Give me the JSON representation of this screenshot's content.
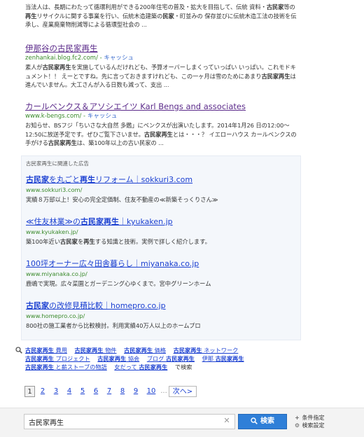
{
  "results": [
    {
      "title": "",
      "url": "",
      "cache": "",
      "snippet_html": "当法人は、長期にわたって循環利用ができる200年住宅の普及・拡大を目指して、伝統 資料・<b>古民家</b>等の<b>再生</b>リサイクルに関する事業を行い、伝統木造建築の<b>民家</b>・町並みの 保存並びに伝統木造工法の技術を伝承し、産業廃棄物削減等による循環型社会の ..."
    },
    {
      "title": "伊那谷の古民家再生",
      "url": "zenhankai.blog.fc2.com/",
      "cache": "キャッシュ",
      "snippet_html": "素人が<b>古民家再生</b>を実施しているんだけれども、予算オーバーしまくっていっぱい いっぱい。これモドキュメント！！ えーとですね。先に言っておきますけれども、この一ヶ月は雪のためにあまり<b>古民家再生</b>は進んでいません。大工さんが入る日数も減って、支出 ..."
    },
    {
      "title": "カールベンクス＆アソシエイツ Karl Bengs and associates",
      "url": "www.k-bengs.com/",
      "cache": "キャッシュ",
      "snippet_html": "お知らせ、BSフジ「ちいさな大自然 多鑑」にベンクスが出演いたします。2014年1月26 日の12:00～12:50に放送予定です。ぜひご覧下さいませ。<b>古民家再生</b>とは・・・？ イエローハウス カールベンクスの手がける<b>古民家再生</b>は、築100年以上の古い民家の ..."
    }
  ],
  "ads": {
    "header": "古民家再生に関連した広告",
    "items": [
      {
        "title_html": "<b>古民家</b>を丸ごと<b>再生</b>リフォーム｜sokkuri3.com",
        "url": "www.sokkuri3.com/",
        "desc_html": "実績８万邸以上！安心の完全定価制、住友不動産の≪新築そっくりさん≫"
      },
      {
        "title_html": "≪住友林業≫の<b>古民家再生</b>｜kyukaken.jp",
        "url": "www.kyukaken.jp/",
        "desc_html": "築100年近い<b>古民家</b>を<b>再生</b>する知識と技術。実例で詳しく紹介します。"
      },
      {
        "title_html": "100坪オーナー広々田舎暮らし｜miyanaka.co.jp",
        "url": "www.miyanaka.co.jp/",
        "desc_html": "鹿嶋で実現。広々菜園とガーデニング心ゆくまで。宮中グリーンホーム"
      },
      {
        "title_html": "<b>古民家</b>の改修見積比較｜homepro.co.jp",
        "url": "www.homepro.co.jp/",
        "desc_html": "800社の施工業者から比較検討。利用実績40万人以上のホームプロ"
      }
    ]
  },
  "related": {
    "rows": [
      [
        "<b>古民家再生</b> 費用",
        "<b>古民家再生</b> 物件",
        "<b>古民家再生</b> 価格",
        "<b>古民家再生</b> ネットワーク"
      ],
      [
        "<b>古民家再生</b> プロジェクト",
        "<b>古民家再生</b> 協会",
        "ブログ <b>古民家再生</b>",
        "伊那 <b>古民家再生</b>"
      ],
      [
        "<b>古民家再生</b> と薪ストーブの物語 ",
        "女だって <b>古民家再生</b>"
      ]
    ],
    "suffix": "で検索"
  },
  "pagination": {
    "pages": [
      "1",
      "2",
      "3",
      "4",
      "5",
      "6",
      "7",
      "8",
      "9",
      "10"
    ],
    "dots": "...",
    "next": "次へ>"
  },
  "searchbar": {
    "query": "古民家再生",
    "button_label": "検索",
    "link_conditions": "条件指定",
    "link_settings": "検索設定"
  },
  "colors": {
    "ad_title": "#1a3fd1",
    "visited_title": "#5b2a8a",
    "url_green": "#3a8a2b",
    "search_button": "#2f7fd8"
  }
}
